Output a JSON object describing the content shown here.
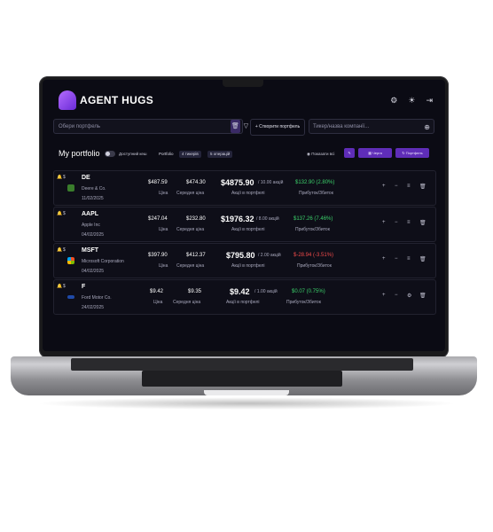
{
  "app": {
    "brand_name": "AGENT HUGS",
    "header_icons": [
      "settings-icon",
      "sun-icon",
      "logout-icon"
    ]
  },
  "toolbar": {
    "portfolio_select_placeholder": "Обери портфель",
    "create_portfolio_label": "Створити портфель",
    "ticker_placeholder": "Тикер/назва компанії..."
  },
  "portfolio_bar": {
    "title": "My portfolio",
    "toggle_label": "Доступний кеш",
    "tabs": [
      "Portfolio",
      "4 тикерів",
      "5 операцій"
    ],
    "show_all_label": "Показати всі",
    "action_labels": [
      "",
      "Черга",
      "Портфель"
    ]
  },
  "holdings": [
    {
      "ticker": "DE",
      "company": "Deere & Co.",
      "date": "11/02/2025",
      "price": "$487.59",
      "price_label": "Ціна",
      "avg_price": "$474.30",
      "avg_label": "Середня ціна",
      "total": "$4875.90",
      "shares": "/ 10.00 акцій",
      "total_label": "Акції в портфелі",
      "pnl": "$132.90 (2.80%)",
      "pnl_label": "Прибуток/Збиток",
      "pnl_sign": "positive",
      "logo_color": "#3a7d2c"
    },
    {
      "ticker": "AAPL",
      "company": "Apple Inc",
      "date": "04/02/2025",
      "price": "$247.04",
      "price_label": "Ціна",
      "avg_price": "$232.80",
      "avg_label": "Середня ціна",
      "total": "$1976.32",
      "shares": "/ 8.00 акцій",
      "total_label": "Акції в портфелі",
      "pnl": "$137.26 (7.46%)",
      "pnl_label": "Прибуток/Збиток",
      "pnl_sign": "positive",
      "logo_color": "#e8e8ee"
    },
    {
      "ticker": "MSFT",
      "company": "Microsoft Corporation",
      "date": "04/02/2025",
      "price": "$397.90",
      "price_label": "Ціна",
      "avg_price": "$412.37",
      "avg_label": "Середня ціна",
      "total": "$795.80",
      "shares": "/ 2.00 акцій",
      "total_label": "Акції в портфелі",
      "pnl": "$-28.94 (-3.51%)",
      "pnl_label": "Прибуток/Збиток",
      "pnl_sign": "negative",
      "logo_color": "#f25022"
    },
    {
      "ticker": "F",
      "company": "Ford Motor Co.",
      "date": "24/02/2025",
      "price": "$9.42",
      "price_label": "Ціна",
      "avg_price": "$9.35",
      "avg_label": "Середня ціна",
      "total": "$9.42",
      "shares": "/ 1.00 акцій",
      "total_label": "Акції в портфелі",
      "pnl": "$0.07 (0.75%)",
      "pnl_label": "Прибуток/Збиток",
      "pnl_sign": "positive",
      "logo_color": "#1f4aa8"
    }
  ],
  "row_actions": [
    "plus-icon",
    "minus-icon",
    "menu-icon",
    "trash-icon"
  ],
  "colors": {
    "accent": "#5f2db8",
    "positive": "#3bd06a",
    "negative": "#f04a4a",
    "screen_bg": "#0b0b14"
  }
}
